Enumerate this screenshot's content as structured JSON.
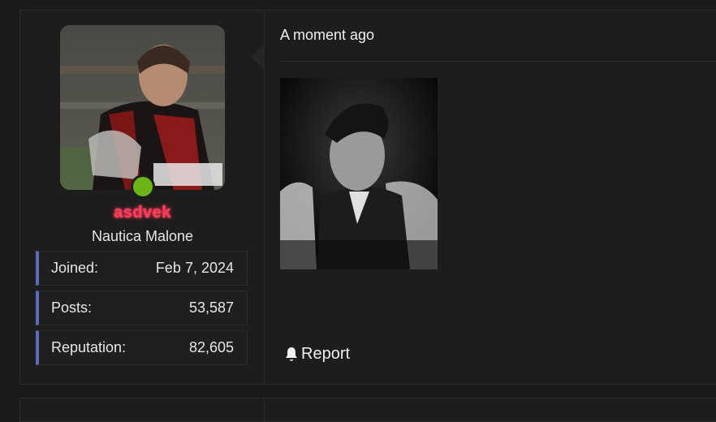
{
  "post": {
    "timestamp": "A moment ago",
    "report_label": "Report"
  },
  "user": {
    "username": "asdvek",
    "user_title": "Nautica Malone",
    "online": true,
    "stats": [
      {
        "label": "Joined:",
        "value": "Feb 7, 2024"
      },
      {
        "label": "Posts:",
        "value": "53,587"
      },
      {
        "label": "Reputation:",
        "value": "82,605"
      }
    ]
  },
  "colors": {
    "username": "#ff3b5b",
    "online_indicator": "#6bb416",
    "stat_accent": "#5c6bc0"
  },
  "icons": {
    "report": "bell-icon"
  }
}
